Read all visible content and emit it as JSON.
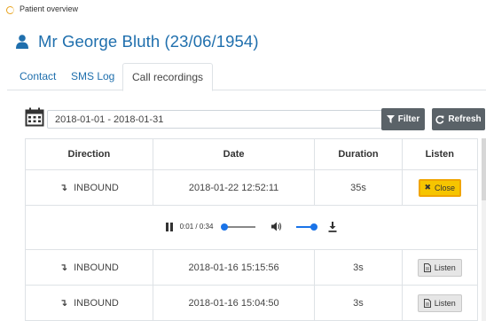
{
  "header": {
    "breadcrumb": "Patient overview"
  },
  "patient": {
    "title": "Mr George Bluth (23/06/1954)"
  },
  "tabs": [
    {
      "label": "Contact"
    },
    {
      "label": "SMS Log"
    },
    {
      "label": "Call recordings",
      "active": true
    }
  ],
  "filter": {
    "date_range": "2018-01-01 - 2018-01-31",
    "filter_label": "Filter",
    "refresh_label": "Refresh"
  },
  "table": {
    "columns": [
      "Direction",
      "Date",
      "Duration",
      "Listen"
    ],
    "rows": [
      {
        "direction": "INBOUND",
        "date": "2018-01-22 12:52:11",
        "duration": "35s",
        "action": "Close"
      },
      {
        "direction": "INBOUND",
        "date": "2018-01-16 15:15:56",
        "duration": "3s",
        "action": "Listen"
      },
      {
        "direction": "INBOUND",
        "date": "2018-01-16 15:04:50",
        "duration": "3s",
        "action": "Listen"
      }
    ]
  },
  "player": {
    "time": "0:01 / 0:34",
    "progress": 0.03,
    "volume": 1.0
  },
  "colors": {
    "link": "#1f6fad",
    "accent": "#f6c500",
    "button_dark": "#5a6268",
    "slider": "#1a73e8"
  }
}
